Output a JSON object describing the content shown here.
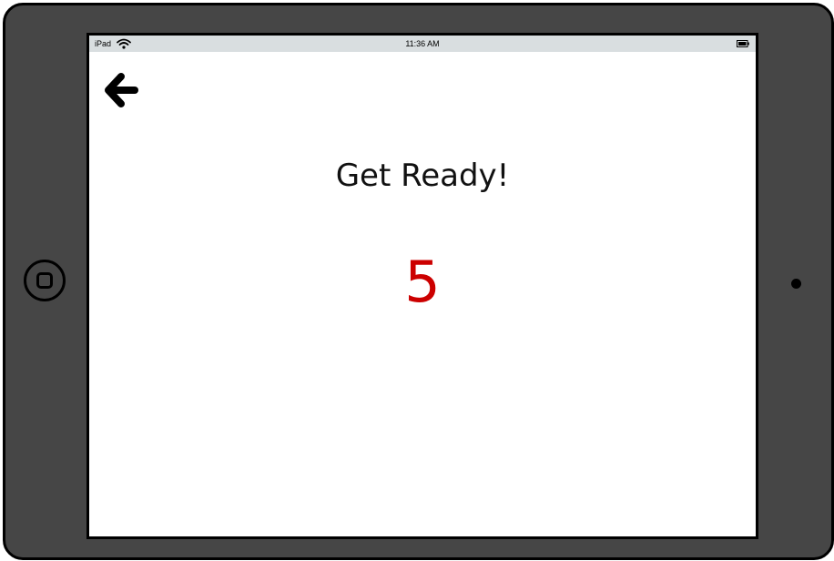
{
  "status_bar": {
    "device": "iPad",
    "time": "11:36 AM",
    "wifi_icon": "wifi-icon",
    "battery_icon": "battery-icon"
  },
  "nav": {
    "back_icon": "back-arrow-icon"
  },
  "main": {
    "heading": "Get Ready!",
    "countdown": "5"
  },
  "colors": {
    "countdown": "#cc0000",
    "device_frame": "#464646",
    "status_bar": "#d9dee0"
  }
}
